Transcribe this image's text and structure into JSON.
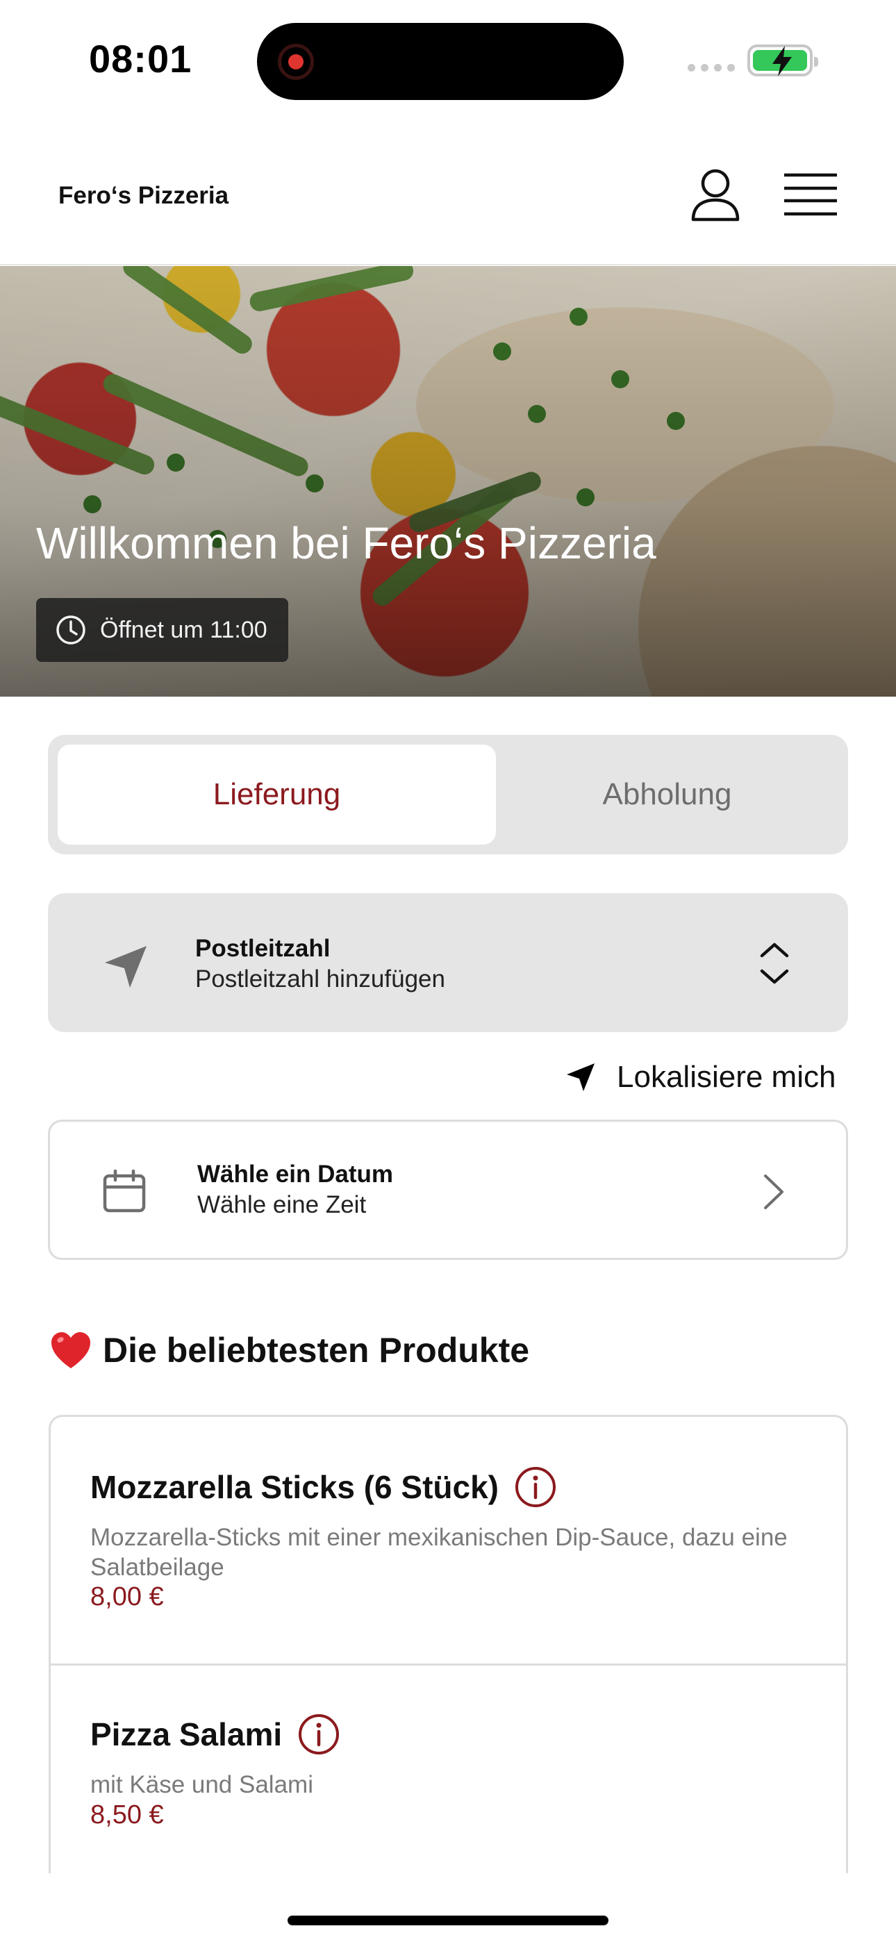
{
  "status_bar": {
    "time": "08:01"
  },
  "header": {
    "brand": "Fero‘s Pizzeria",
    "icons": [
      "user-icon",
      "menu-icon"
    ]
  },
  "hero": {
    "title": "Willkommen bei Fero‘s Pizzeria",
    "hours": "Öffnet um 11:00",
    "icon": "clock-icon"
  },
  "mode_switch": {
    "active": "Lieferung",
    "inactive": "Abholung"
  },
  "postcode": {
    "label": "Postleitzahl",
    "value": "Postleitzahl hinzufügen",
    "icon": "location-arrow-icon"
  },
  "locate": {
    "label": "Lokalisiere mich",
    "icon": "location-arrow-icon"
  },
  "date_picker": {
    "label": "Wähle ein Datum",
    "value": "Wähle eine Zeit",
    "icon": "calendar-icon"
  },
  "popular": {
    "title": "Die beliebtesten Produkte",
    "icon": "heart-icon",
    "products": [
      {
        "name": "Mozzarella Sticks (6 Stück)",
        "description": "Mozzarella-Sticks mit einer mexikanischen Dip-Sauce, dazu eine Salatbeilage",
        "price": "8,00 €"
      },
      {
        "name": "Pizza Salami",
        "description": "mit Käse und Salami",
        "price": "8,50 €"
      }
    ]
  },
  "colors": {
    "accent": "#8b1a1e",
    "panel": "#e5e5e5",
    "battery": "#34c759"
  }
}
